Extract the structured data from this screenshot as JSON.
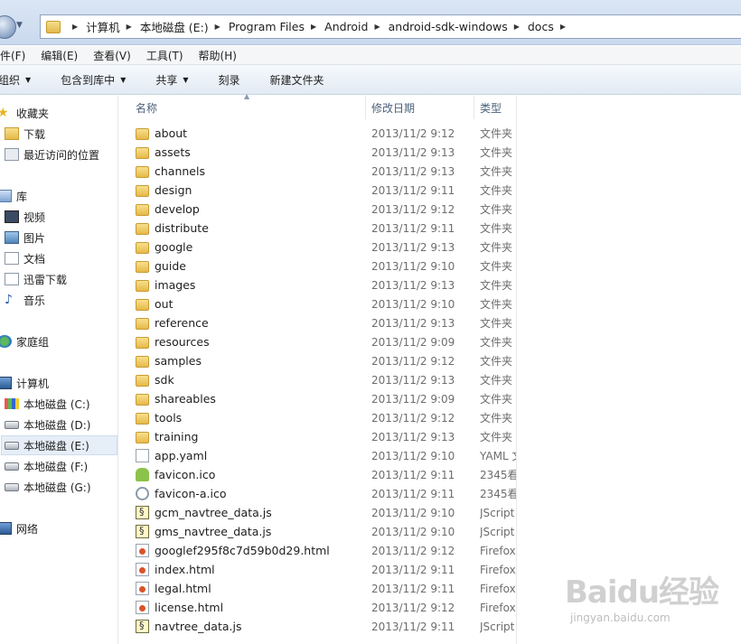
{
  "address": {
    "crumbs": [
      "计算机",
      "本地磁盘 (E:)",
      "Program Files",
      "Android",
      "android-sdk-windows",
      "docs"
    ]
  },
  "menu": [
    "件(F)",
    "编辑(E)",
    "查看(V)",
    "工具(T)",
    "帮助(H)"
  ],
  "commands": [
    {
      "label": "组织",
      "dropdown": true
    },
    {
      "label": "包含到库中",
      "dropdown": true
    },
    {
      "label": "共享",
      "dropdown": true
    },
    {
      "label": "刻录",
      "dropdown": false
    },
    {
      "label": "新建文件夹",
      "dropdown": false
    }
  ],
  "nav": {
    "favorites": "收藏夹",
    "downloads": "下载",
    "recent": "最近访问的位置",
    "libraries": "库",
    "videos": "视频",
    "pictures": "图片",
    "documents": "文档",
    "xunlei": "迅雷下载",
    "music": "音乐",
    "homegroup": "家庭组",
    "computer": "计算机",
    "drive_c": "本地磁盘 (C:)",
    "drive_d": "本地磁盘 (D:)",
    "drive_e": "本地磁盘 (E:)",
    "drive_f": "本地磁盘 (F:)",
    "drive_g": "本地磁盘 (G:)",
    "network": "网络"
  },
  "columns": {
    "name": "名称",
    "date": "修改日期",
    "type": "类型"
  },
  "files": [
    {
      "name": "about",
      "date": "2013/11/2 9:12",
      "type": "文件夹",
      "icon": "folder-icon"
    },
    {
      "name": "assets",
      "date": "2013/11/2 9:13",
      "type": "文件夹",
      "icon": "folder-icon"
    },
    {
      "name": "channels",
      "date": "2013/11/2 9:13",
      "type": "文件夹",
      "icon": "folder-icon"
    },
    {
      "name": "design",
      "date": "2013/11/2 9:11",
      "type": "文件夹",
      "icon": "folder-icon"
    },
    {
      "name": "develop",
      "date": "2013/11/2 9:12",
      "type": "文件夹",
      "icon": "folder-icon"
    },
    {
      "name": "distribute",
      "date": "2013/11/2 9:11",
      "type": "文件夹",
      "icon": "folder-icon"
    },
    {
      "name": "google",
      "date": "2013/11/2 9:13",
      "type": "文件夹",
      "icon": "folder-icon"
    },
    {
      "name": "guide",
      "date": "2013/11/2 9:10",
      "type": "文件夹",
      "icon": "folder-icon"
    },
    {
      "name": "images",
      "date": "2013/11/2 9:13",
      "type": "文件夹",
      "icon": "folder-icon"
    },
    {
      "name": "out",
      "date": "2013/11/2 9:10",
      "type": "文件夹",
      "icon": "folder-icon"
    },
    {
      "name": "reference",
      "date": "2013/11/2 9:13",
      "type": "文件夹",
      "icon": "folder-icon"
    },
    {
      "name": "resources",
      "date": "2013/11/2 9:09",
      "type": "文件夹",
      "icon": "folder-icon"
    },
    {
      "name": "samples",
      "date": "2013/11/2 9:12",
      "type": "文件夹",
      "icon": "folder-icon"
    },
    {
      "name": "sdk",
      "date": "2013/11/2 9:13",
      "type": "文件夹",
      "icon": "folder-icon"
    },
    {
      "name": "shareables",
      "date": "2013/11/2 9:09",
      "type": "文件夹",
      "icon": "folder-icon"
    },
    {
      "name": "tools",
      "date": "2013/11/2 9:12",
      "type": "文件夹",
      "icon": "folder-icon"
    },
    {
      "name": "training",
      "date": "2013/11/2 9:13",
      "type": "文件夹",
      "icon": "folder-icon"
    },
    {
      "name": "app.yaml",
      "date": "2013/11/2 9:10",
      "type": "YAML 文",
      "icon": "file-icon"
    },
    {
      "name": "favicon.ico",
      "date": "2013/11/2 9:11",
      "type": "2345看",
      "icon": "android-icon"
    },
    {
      "name": "favicon-a.ico",
      "date": "2013/11/2 9:11",
      "type": "2345看",
      "icon": "android-a-icon"
    },
    {
      "name": "gcm_navtree_data.js",
      "date": "2013/11/2 9:10",
      "type": "JScript",
      "icon": "jscript-icon"
    },
    {
      "name": "gms_navtree_data.js",
      "date": "2013/11/2 9:10",
      "type": "JScript",
      "icon": "jscript-icon"
    },
    {
      "name": "googlef295f8c7d59b0d29.html",
      "date": "2013/11/2 9:12",
      "type": "Firefox",
      "icon": "firefox-html-icon"
    },
    {
      "name": "index.html",
      "date": "2013/11/2 9:11",
      "type": "Firefox",
      "icon": "firefox-html-icon"
    },
    {
      "name": "legal.html",
      "date": "2013/11/2 9:11",
      "type": "Firefox",
      "icon": "firefox-html-icon"
    },
    {
      "name": "license.html",
      "date": "2013/11/2 9:12",
      "type": "Firefox",
      "icon": "firefox-html-icon"
    },
    {
      "name": "navtree_data.js",
      "date": "2013/11/2 9:11",
      "type": "JScript",
      "icon": "jscript-icon"
    }
  ],
  "watermark": {
    "logo": "Baidu经验",
    "url": "jingyan.baidu.com"
  }
}
